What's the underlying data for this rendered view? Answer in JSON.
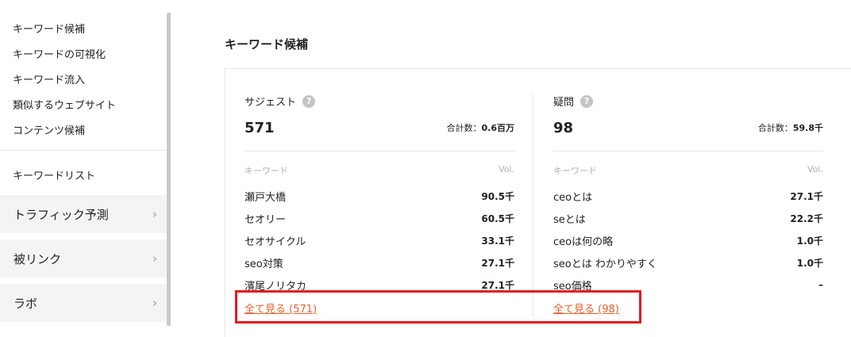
{
  "sidebar": {
    "links": [
      "キーワード候補",
      "キーワードの可視化",
      "キーワード流入",
      "類似するウェブサイト",
      "コンテンツ候補"
    ],
    "keyword_list": "キーワードリスト",
    "groups": [
      {
        "label": "トラフィック予測",
        "chevron": "›"
      },
      {
        "label": "被リンク",
        "chevron": "›"
      },
      {
        "label": "ラボ",
        "chevron": "›"
      }
    ]
  },
  "main": {
    "title": "キーワード候補",
    "help_glyph": "?",
    "suggest": {
      "heading": "サジェスト",
      "count": "571",
      "total_label": "合計数：",
      "total_value": "0.6百万",
      "col_keyword": "キーワード",
      "col_vol": "Vol.",
      "rows": [
        {
          "keyword": "瀬戸大橋",
          "vol": "90.5千"
        },
        {
          "keyword": "セオリー",
          "vol": "60.5千"
        },
        {
          "keyword": "セオサイクル",
          "vol": "33.1千"
        },
        {
          "keyword": "seo対策",
          "vol": "27.1千"
        },
        {
          "keyword": "濱尾ノリタカ",
          "vol": "27.1千"
        }
      ],
      "see_all": "全て見る (571)"
    },
    "questions": {
      "heading": "疑問",
      "count": "98",
      "total_label": "合計数：",
      "total_value": "59.8千",
      "col_keyword": "キーワード",
      "col_vol": "Vol.",
      "rows": [
        {
          "keyword": "ceoとは",
          "vol": "27.1千"
        },
        {
          "keyword": "seとは",
          "vol": "22.2千"
        },
        {
          "keyword": "ceoは何の略",
          "vol": "1.0千"
        },
        {
          "keyword": "seoとは わかりやすく",
          "vol": "1.0千"
        },
        {
          "keyword": "seo価格",
          "vol": "–"
        }
      ],
      "see_all": "全て見る (98)"
    }
  },
  "colors": {
    "accent": "#e8602b",
    "highlight": "#e11b22"
  }
}
